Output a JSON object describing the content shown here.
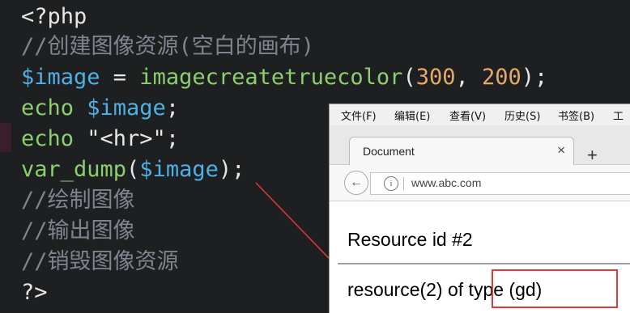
{
  "editor": {
    "lines": [
      {
        "tokens": [
          {
            "t": "<?php",
            "c": "c-white"
          }
        ]
      },
      {
        "tokens": [
          {
            "t": "//创建图像资源(空白的画布)",
            "c": "c-comment"
          }
        ]
      },
      {
        "tokens": [
          {
            "t": "$image",
            "c": "c-var"
          },
          {
            "t": " = ",
            "c": "c-op"
          },
          {
            "t": "imagecreatetruecolor",
            "c": "c-func"
          },
          {
            "t": "(",
            "c": "c-white"
          },
          {
            "t": "300",
            "c": "c-num"
          },
          {
            "t": ", ",
            "c": "c-white"
          },
          {
            "t": "200",
            "c": "c-num"
          },
          {
            "t": ");",
            "c": "c-white"
          }
        ]
      },
      {
        "tokens": [
          {
            "t": "echo ",
            "c": "c-kw"
          },
          {
            "t": "$image",
            "c": "c-var"
          },
          {
            "t": ";",
            "c": "c-white"
          }
        ]
      },
      {
        "tokens": [
          {
            "t": "echo ",
            "c": "c-kw"
          },
          {
            "t": "\"<hr>\"",
            "c": "c-str"
          },
          {
            "t": ";",
            "c": "c-white"
          }
        ]
      },
      {
        "tokens": [
          {
            "t": "var_dump",
            "c": "c-func"
          },
          {
            "t": "(",
            "c": "c-white"
          },
          {
            "t": "$image",
            "c": "c-var"
          },
          {
            "t": ");",
            "c": "c-white"
          }
        ]
      },
      {
        "tokens": [
          {
            "t": "//绘制图像",
            "c": "c-comment"
          }
        ]
      },
      {
        "tokens": [
          {
            "t": "//输出图像",
            "c": "c-comment"
          }
        ]
      },
      {
        "tokens": [
          {
            "t": "//销毁图像资源",
            "c": "c-comment"
          }
        ]
      },
      {
        "tokens": [
          {
            "t": "?>",
            "c": "c-white"
          }
        ]
      }
    ]
  },
  "browser": {
    "menu": [
      "文件(F)",
      "编辑(E)",
      "查看(V)",
      "历史(S)",
      "书签(B)",
      "工具"
    ],
    "tab_title": "Document",
    "tab_close": "×",
    "new_tab": "+",
    "back_icon": "←",
    "info_icon": "i",
    "url": "www.abc.com",
    "output_line1": "Resource id #2",
    "output_line2": "resource(2) of type (gd)"
  },
  "colors": {
    "annotation_red": "#e0393e",
    "editor_bg": "#1d1f21"
  }
}
